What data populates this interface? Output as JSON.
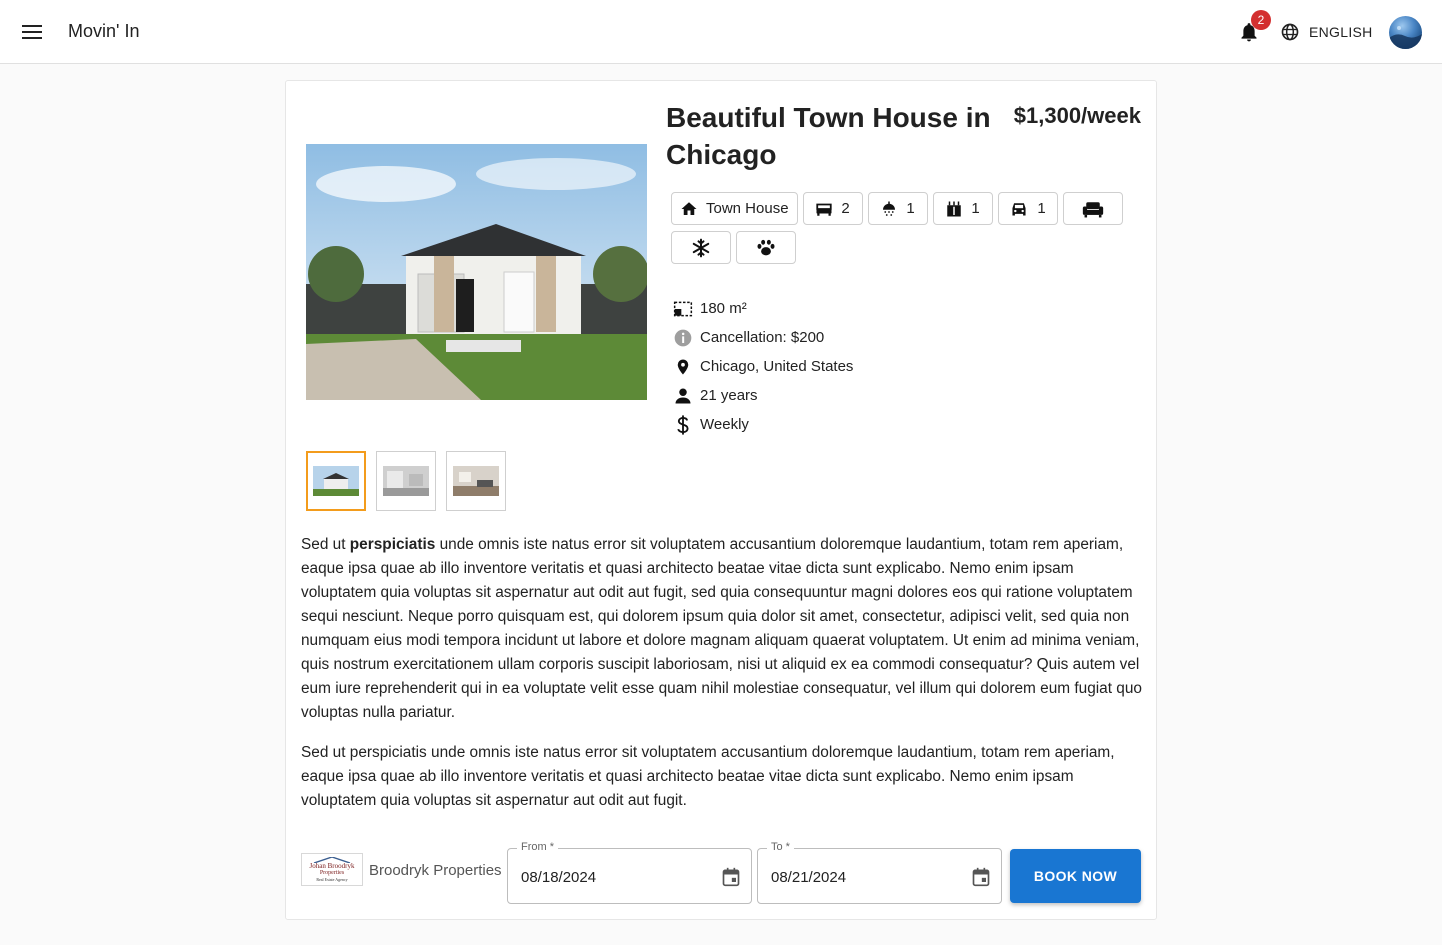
{
  "app": {
    "title": "Movin' In"
  },
  "header": {
    "notification_count": "2",
    "language": "ENGLISH"
  },
  "listing": {
    "title": "Beautiful Town House in Chicago",
    "price": "$1,300/week",
    "features": [
      {
        "icon": "home-icon",
        "label": "Town House"
      },
      {
        "icon": "bed-icon",
        "label": "2"
      },
      {
        "icon": "shower-icon",
        "label": "1"
      },
      {
        "icon": "kitchen-icon",
        "label": "1"
      },
      {
        "icon": "car-icon",
        "label": "1"
      },
      {
        "icon": "couch-icon",
        "label": ""
      },
      {
        "icon": "snowflake-icon",
        "label": ""
      },
      {
        "icon": "paw-icon",
        "label": ""
      }
    ],
    "size": "180 m²",
    "cancellation": "Cancellation: $200",
    "location": "Chicago, United States",
    "min_age": "21 years",
    "payment": "Weekly",
    "description_p1_start": "Sed ut ",
    "description_p1_bold": "perspiciatis",
    "description_p1_rest": " unde omnis iste natus error sit voluptatem accusantium doloremque laudantium, totam rem aperiam, eaque ipsa quae ab illo inventore veritatis et quasi architecto beatae vitae dicta sunt explicabo. Nemo enim ipsam voluptatem quia voluptas sit aspernatur aut odit aut fugit, sed quia consequuntur magni dolores eos qui ratione voluptatem sequi nesciunt. Neque porro quisquam est, qui dolorem ipsum quia dolor sit amet, consectetur, adipisci velit, sed quia non numquam eius modi tempora incidunt ut labore et dolore magnam aliquam quaerat voluptatem. Ut enim ad minima veniam, quis nostrum exercitationem ullam corporis suscipit laboriosam, nisi ut aliquid ex ea commodi consequatur? Quis autem vel eum iure reprehenderit qui in ea voluptate velit esse quam nihil molestiae consequatur, vel illum qui dolorem eum fugiat quo voluptas nulla pariatur.",
    "description_p2": "Sed ut perspiciatis unde omnis iste natus error sit voluptatem accusantium doloremque laudantium, totam rem aperiam, eaque ipsa quae ab illo inventore veritatis et quasi architecto beatae vitae dicta sunt explicabo. Nemo enim ipsam voluptatem quia voluptas sit aspernatur aut odit aut fugit."
  },
  "owner": {
    "name": "Broodryk Properties",
    "logo_line1": "Johan Broodryk",
    "logo_line2": "Properties",
    "logo_line3": "Real Estate Agency"
  },
  "booking": {
    "from_label": "From *",
    "from_value": "08/18/2024",
    "to_label": "To *",
    "to_value": "08/21/2024",
    "book_label": "BOOK NOW"
  },
  "colors": {
    "accent": "#1976d2",
    "badge": "#d32f2f",
    "thumb_active": "#f39c1c"
  }
}
